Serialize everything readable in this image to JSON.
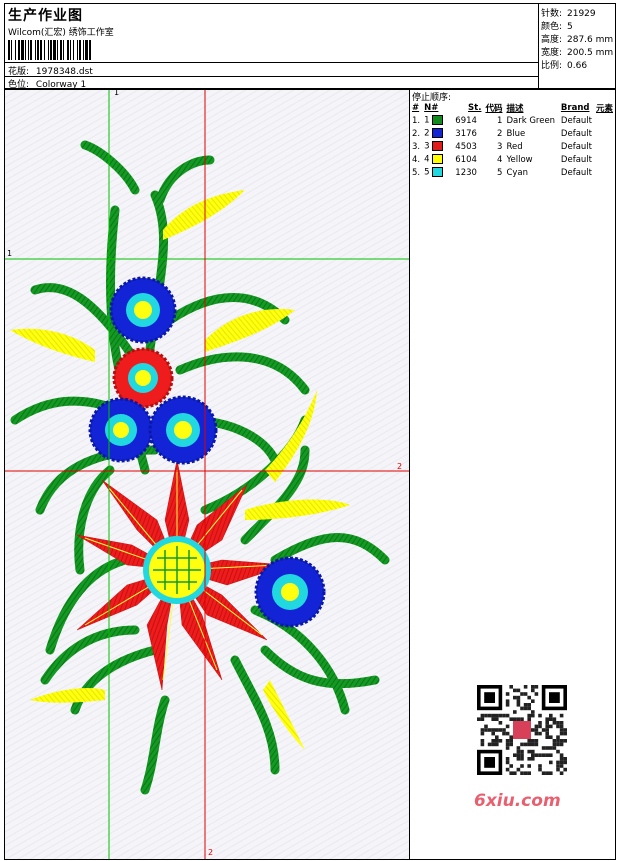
{
  "header": {
    "title": "生产作业图",
    "subtitle": "Wilcom(汇宏) 绣饰工作室",
    "design_label": "花版:",
    "design_value": "1978348.dst",
    "colorway_label": "色位:",
    "colorway_value": "Colorway 1"
  },
  "stats": {
    "stitches_label": "针数:",
    "stitches_value": "21929",
    "colors_label": "颜色:",
    "colors_value": "5",
    "height_label": "高度:",
    "height_value": "287.6 mm",
    "width_label": "宽度:",
    "width_value": "200.5 mm",
    "scale_label": "比例:",
    "scale_value": "0.66"
  },
  "stop_sequence": {
    "title": "停止顺序:",
    "columns": [
      "#",
      "N#",
      "St.",
      "代码",
      "描述",
      "Brand",
      "元素"
    ],
    "rows": [
      {
        "num": "1.",
        "n": "1",
        "color": "#138a1e",
        "st": "6914",
        "code": "1",
        "desc": "Dark Green",
        "brand": "Default"
      },
      {
        "num": "2.",
        "n": "2",
        "color": "#1224d6",
        "st": "3176",
        "code": "2",
        "desc": "Blue",
        "brand": "Default"
      },
      {
        "num": "3.",
        "n": "3",
        "color": "#e21b1b",
        "st": "4503",
        "code": "3",
        "desc": "Red",
        "brand": "Default"
      },
      {
        "num": "4.",
        "n": "4",
        "color": "#ffff00",
        "st": "6104",
        "code": "4",
        "desc": "Yellow",
        "brand": "Default"
      },
      {
        "num": "5.",
        "n": "5",
        "color": "#22d8e0",
        "st": "1230",
        "code": "5",
        "desc": "Cyan",
        "brand": "Default"
      }
    ]
  },
  "guides": {
    "green_v_label": "1",
    "green_h_label": "1",
    "red_h_label": "2",
    "red_v_label": "2",
    "green_color": "#00c000",
    "red_color": "#e00000"
  },
  "watermark": {
    "text": "6xiu.com"
  }
}
